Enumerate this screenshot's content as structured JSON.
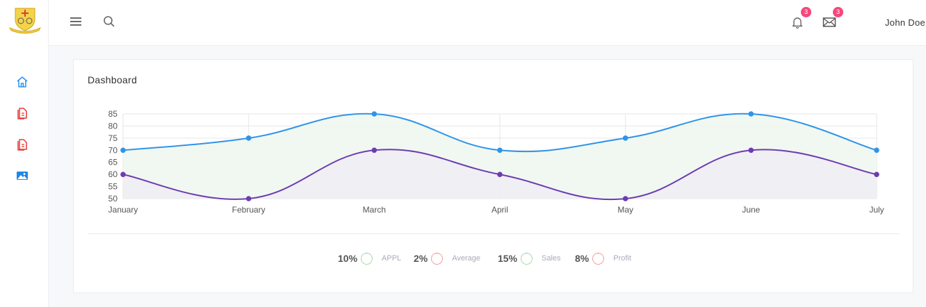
{
  "app": {
    "user_name": "John Doe"
  },
  "topbar": {
    "notifications": {
      "count": "3",
      "icon": "bell-icon"
    },
    "messages": {
      "count": "3",
      "icon": "envelope-icon"
    }
  },
  "sidebar": {
    "items": [
      {
        "icon": "home-icon",
        "color": "#2d8ff0"
      },
      {
        "icon": "document-icon",
        "color": "#e53935"
      },
      {
        "icon": "document-icon",
        "color": "#e53935"
      },
      {
        "icon": "image-icon",
        "color": "#1e88e5"
      }
    ]
  },
  "card": {
    "title": "Dashboard"
  },
  "colors": {
    "series_1": "#2f94e9",
    "series_2": "#6d3bb1",
    "fill_1": "#eef7ef",
    "fill_2": "#eeedf4"
  },
  "chart_data": {
    "type": "line",
    "categories": [
      "January",
      "February",
      "March",
      "April",
      "May",
      "June",
      "July"
    ],
    "series": [
      {
        "values": [
          70,
          75,
          85,
          70,
          75,
          85,
          70
        ],
        "color": "#2f94e9"
      },
      {
        "values": [
          60,
          50,
          70,
          60,
          50,
          70,
          60
        ],
        "color": "#6d3bb1"
      }
    ],
    "y_ticks": [
      "85",
      "80",
      "75",
      "70",
      "65",
      "60",
      "55",
      "50"
    ],
    "ylim": [
      50,
      85
    ],
    "grid": true,
    "smooth": true,
    "filled": true
  },
  "legend": [
    {
      "pct": "10%",
      "name": "APPL",
      "color": "#4caf50"
    },
    {
      "pct": "2%",
      "name": "Average",
      "color": "#e53935"
    },
    {
      "pct": "15%",
      "name": "Sales",
      "color": "#4caf50"
    },
    {
      "pct": "8%",
      "name": "Profit",
      "color": "#e53935"
    }
  ]
}
